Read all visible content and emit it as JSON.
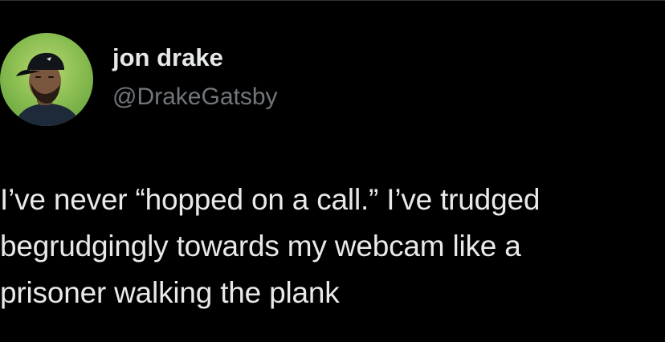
{
  "author": {
    "display_name": "jon drake",
    "handle": "@DrakeGatsby",
    "avatar_icon": "profile-photo"
  },
  "tweet": {
    "lines": [
      "I’ve never “hopped on a call.” I’ve trudged",
      "begrudgingly towards my webcam like a",
      "prisoner walking the plank"
    ]
  },
  "colors": {
    "background": "#000000",
    "primary_text": "#e7e9ea",
    "secondary_text": "#71767b",
    "avatar_background": "#8cbf52"
  }
}
